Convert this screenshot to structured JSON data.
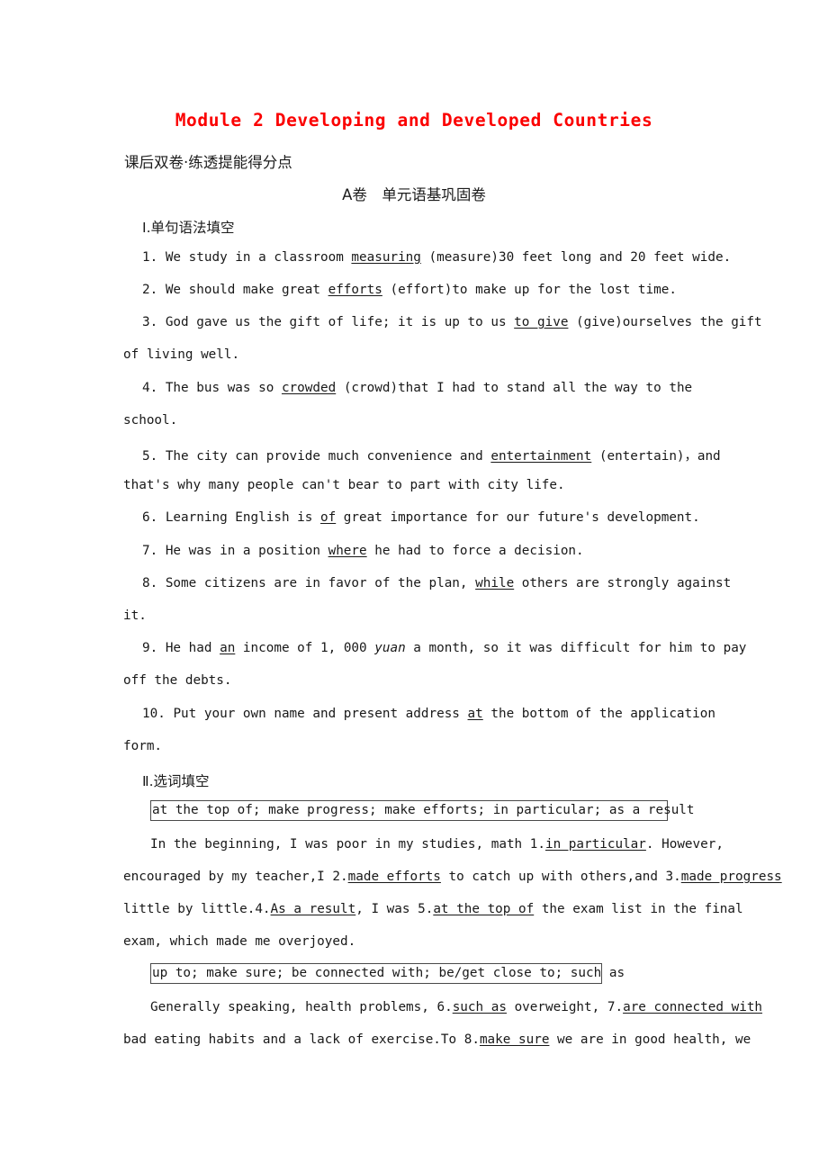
{
  "document": {
    "title": "Module 2 Developing and Developed Countries",
    "title_color": "#fb0000",
    "subtitle": "课后双卷·练透提能得分点",
    "part_banner": "A卷　单元语基巩固卷"
  },
  "sections": [
    {
      "heading": "Ⅰ.单句语法填空",
      "items": [
        {
          "number": "1.",
          "lines": [
            "1. We study in a classroom measuring (measure)30 feet long and 20 feet wide."
          ]
        },
        {
          "number": "2.",
          "lines": [
            "2. We should make great efforts (effort)to make up for the lost time."
          ]
        },
        {
          "number": "3.",
          "lines": [
            "3. God gave us the gift of life; it is up to us to give (give)ourselves the gift",
            "of living well."
          ]
        },
        {
          "number": "4.",
          "lines": [
            "4. The bus was so crowded (crowd)that I had to stand all the way to the",
            "school."
          ]
        },
        {
          "number": "5.",
          "lines": [
            "5. The city can provide much convenience and entertainment (entertain)，and",
            "that's why many people can't bear to part with city life."
          ]
        },
        {
          "number": "6.",
          "lines": [
            "6. Learning English is of great importance for our future's development."
          ]
        },
        {
          "number": "7.",
          "lines": [
            "7. He was in a position where he had to force a decision."
          ]
        },
        {
          "number": "8.",
          "lines": [
            "8. Some citizens are in favor of the plan, while others are strongly against",
            "it."
          ]
        },
        {
          "number": "9.",
          "lines": [
            "9. He had an income of 1, 000 yuan a month, so it was difficult for him to pay",
            "off the debts."
          ]
        },
        {
          "number": "10.",
          "lines": [
            "10. Put your own name and present address at the bottom of the application",
            "form."
          ]
        }
      ]
    },
    {
      "heading": "Ⅱ.选词填空",
      "word_banks": [
        "at the top of; make progress; make efforts; in particular; as a result",
        "up to; make sure; be connected with; be/get close to; such as"
      ]
    }
  ],
  "q1": {
    "num": "1. ",
    "pre": "We study in a classroom ",
    "ans": "measuring",
    "post": " (measure)30 feet long and 20 feet wide."
  },
  "q2": {
    "num": "2. ",
    "pre": "We should make great ",
    "ans": "efforts",
    "post": " (effort)to make up for the lost time."
  },
  "q3": {
    "num": "3. ",
    "pre": "God gave us the gift of life; it is up to us ",
    "ans": "to give",
    "post": " (give)ourselves the gift",
    "cont": "of living well."
  },
  "q4": {
    "num": "4. ",
    "pre": "The bus was so ",
    "ans": "crowded",
    "post": " (crowd)that I had to stand all the way to the",
    "cont": "school."
  },
  "q5": {
    "num": "5. ",
    "pre": "The city can provide much convenience and ",
    "ans": "entertainment",
    "post": " (entertain)，and",
    "cont": "that's why many people can't bear to part with city life."
  },
  "q6": {
    "num": "6. ",
    "pre": "Learning English is ",
    "ans": "of",
    "post": " great importance for our future's development."
  },
  "q7": {
    "num": "7. ",
    "pre": "He was in a position ",
    "ans": "where",
    "post": " he had to force a decision."
  },
  "q8": {
    "num": "8. ",
    "pre": "Some citizens are in favor of the plan, ",
    "ans": "while",
    "post": " others are strongly against",
    "cont": "it."
  },
  "q9": {
    "num": "9. ",
    "pre": "He had ",
    "ans": "an",
    "mid": " income of 1, 000 ",
    "ital": "yuan",
    "post": " a month, so it was difficult for him to pay",
    "cont": "off the debts."
  },
  "q10": {
    "num": "10. ",
    "pre": "Put your own name and present address ",
    "ans": "at",
    "post": " the bottom of the application",
    "cont": "form."
  },
  "bank1": {
    "text": "at the top of; make progress; make efforts; in particular; as a result"
  },
  "bank2": {
    "text": "up to; make sure; be connected with; be/get close to; such as"
  },
  "cloze1": {
    "l1a": "In the beginning, I was poor in my studies, math 1.",
    "l1ans": "in particular",
    "l1b": ". However,",
    "l2a": "encouraged by my teacher,I 2.",
    "l2ans": "made efforts",
    "l2b": " to catch up with others,and 3.",
    "l2ans2": "made progress",
    "l3a": "little by little.4.",
    "l3ans": "As a result",
    "l3b": ", I was 5.",
    "l3ans2": "at the top of",
    "l3c": " the exam list in the final",
    "l4": "exam, which made me overjoyed."
  },
  "cloze2": {
    "l1a": "Generally speaking, health problems, 6.",
    "l1ans": "such as",
    "l1b": " overweight, 7.",
    "l1ans2": "are connected with",
    "l2a": "bad eating habits and a lack of exercise.To 8.",
    "l2ans": "make sure",
    "l2b": " we are in good health, we"
  }
}
